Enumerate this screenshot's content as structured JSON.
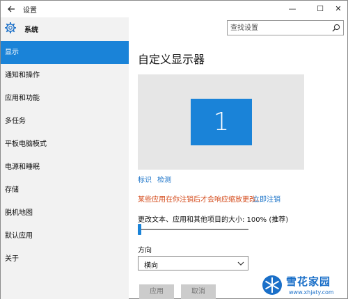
{
  "window": {
    "title": "设置",
    "back_icon": "arrow-left-icon",
    "controls": {
      "minimize": "—",
      "maximize": "☐",
      "close": "✕"
    }
  },
  "sidebar": {
    "header": {
      "icon": "gear-icon",
      "title": "系统"
    },
    "items": [
      {
        "label": "显示",
        "active": true
      },
      {
        "label": "通知和操作",
        "active": false
      },
      {
        "label": "应用和功能",
        "active": false
      },
      {
        "label": "多任务",
        "active": false
      },
      {
        "label": "平板电脑模式",
        "active": false
      },
      {
        "label": "电源和睡眠",
        "active": false
      },
      {
        "label": "存储",
        "active": false
      },
      {
        "label": "脱机地图",
        "active": false
      },
      {
        "label": "默认应用",
        "active": false
      },
      {
        "label": "关于",
        "active": false
      }
    ]
  },
  "search": {
    "placeholder": "查找设置",
    "icon": "search-icon"
  },
  "main": {
    "title": "自定义显示器",
    "monitor_number": "1",
    "identify_label": "标识",
    "detect_label": "检测",
    "warning": "某些应用在你注销后才会响应缩放更改。",
    "signout_label": "立即注销",
    "scale_label": "更改文本、应用和其他项目的大小: 100% (推荐)",
    "scale_value_percent": 100,
    "orientation_label": "方向",
    "orientation_value": "横向",
    "apply_label": "应用",
    "cancel_label": "取消"
  },
  "watermark": {
    "text": "雪花家园",
    "url": "www.xhjaty.com"
  },
  "colors": {
    "accent": "#1a83d8",
    "sidebar_bg": "#f2f2f2",
    "warning": "#d44a1a",
    "link": "#1a73c8"
  }
}
